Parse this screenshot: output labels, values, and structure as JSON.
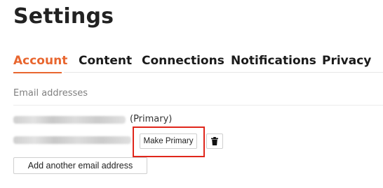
{
  "page": {
    "title": "Settings"
  },
  "tabs": [
    {
      "label": "Account",
      "active": true
    },
    {
      "label": "Content",
      "active": false
    },
    {
      "label": "Connections",
      "active": false
    },
    {
      "label": "Notifications",
      "active": false
    },
    {
      "label": "Privacy",
      "active": false
    }
  ],
  "email_section": {
    "heading": "Email addresses",
    "primary_tag": "(Primary)",
    "make_primary_label": "Make Primary",
    "add_email_label": "Add another email address"
  },
  "colors": {
    "accent": "#e8662f",
    "highlight": "#e0261b"
  },
  "icons": {
    "delete": "trash-icon"
  }
}
